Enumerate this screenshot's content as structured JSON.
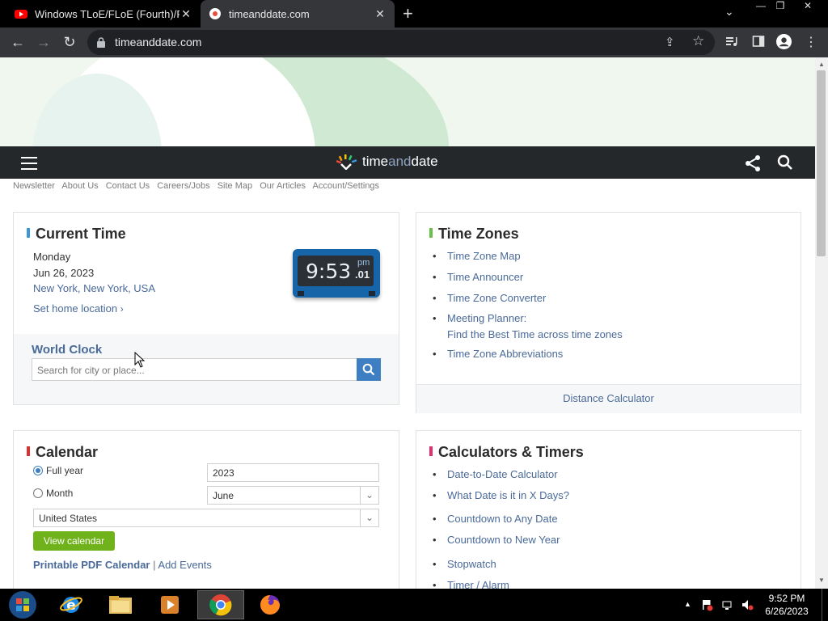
{
  "browser": {
    "tabs": [
      {
        "title": "Windows TLoE/FLoE (Fourth)/FLo",
        "favicon": "youtube-icon"
      },
      {
        "title": "timeanddate.com",
        "favicon": "timeanddate-favicon"
      }
    ],
    "url": "timeanddate.com"
  },
  "site": {
    "logo_main": "time",
    "logo_and": "and",
    "logo_end": "date",
    "topnav": [
      "Newsletter",
      "About Us",
      "Contact Us",
      "Careers/Jobs",
      "Site Map",
      "Our Articles",
      "Account/Settings"
    ]
  },
  "current_time": {
    "heading": "Current Time",
    "weekday": "Monday",
    "date": "Jun 26, 2023",
    "location": "New York, New York, USA",
    "set_home": "Set home location",
    "clock_time": "9:53",
    "clock_ampm": "pm",
    "clock_seconds": ".01"
  },
  "world_clock": {
    "heading": "World Clock",
    "placeholder": "Search for city or place..."
  },
  "time_zones": {
    "heading": "Time Zones",
    "links": [
      "Time Zone Map",
      "Time Announcer",
      "Time Zone Converter"
    ],
    "meeting_planner_line1": "Meeting Planner:",
    "meeting_planner_line2": "Find the Best Time across time zones",
    "abbreviations": "Time Zone Abbreviations",
    "footer": "Distance Calculator"
  },
  "calendar": {
    "heading": "Calendar",
    "full_year_label": "Full year",
    "month_label": "Month",
    "year_value": "2023",
    "month_value": "June",
    "country_value": "United States",
    "view_button": "View calendar",
    "pdf_link": "Printable PDF Calendar",
    "separator": "|",
    "events_link": "Add Events"
  },
  "calculators": {
    "heading": "Calculators & Timers",
    "links": [
      "Date-to-Date Calculator",
      "What Date is it in X Days?",
      "Countdown to Any Date",
      "Countdown to New Year",
      "Stopwatch",
      "Timer / Alarm"
    ]
  },
  "taskbar": {
    "time": "9:52 PM",
    "date": "6/26/2023"
  },
  "colors": {
    "site_bar": "#25282b",
    "link": "#4a6a99",
    "current_time_accent": "#3a9ad9",
    "time_zones_accent": "#6cc04a",
    "calendar_accent": "#e03131",
    "calculators_accent": "#e0306f",
    "view_button": "#6fb21b"
  }
}
